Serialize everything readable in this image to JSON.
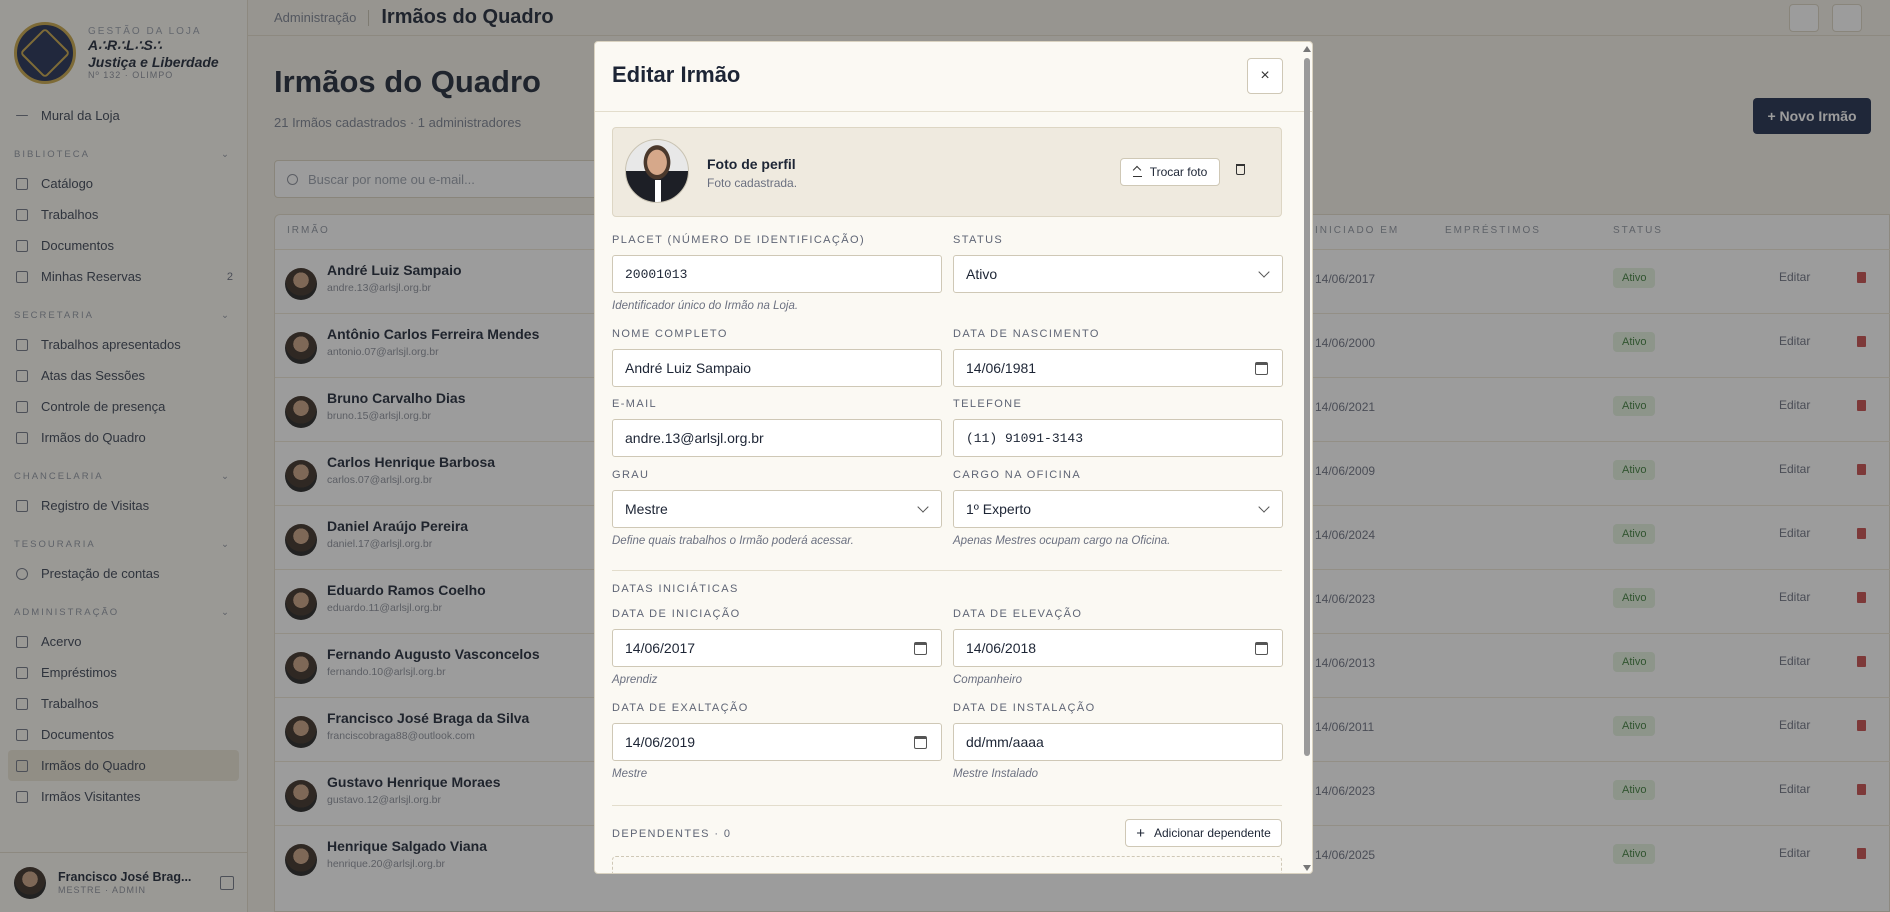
{
  "sidebar": {
    "eyebrow": "GESTÃO DA LOJA",
    "brand_name": "A∴R∴L∴S∴",
    "brand_name2": "Justiça e Liberdade",
    "brand_sub": "Nº 132 · OLIMPO",
    "back_item": "Mural da Loja",
    "sections": [
      {
        "title": "BIBLIOTECA",
        "items": [
          "Catálogo",
          "Trabalhos",
          "Documentos",
          "Minhas Reservas"
        ],
        "badge": "2"
      },
      {
        "title": "SECRETARIA",
        "items": [
          "Trabalhos apresentados",
          "Atas das Sessões",
          "Controle de presença",
          "Irmãos do Quadro"
        ]
      },
      {
        "title": "CHANCELARIA",
        "items": [
          "Registro de Visitas"
        ]
      },
      {
        "title": "TESOURARIA",
        "items": [
          "Prestação de contas"
        ]
      },
      {
        "title": "ADMINISTRAÇÃO",
        "items": [
          "Acervo",
          "Empréstimos",
          "Trabalhos",
          "Documentos",
          "Irmãos do Quadro",
          "Irmãos Visitantes"
        ]
      }
    ],
    "user_name": "Francisco José Brag...",
    "user_role": "MESTRE · ADMIN"
  },
  "topbar": {
    "crumb": "Administração",
    "current": "Irmãos do Quadro"
  },
  "page": {
    "title": "Irmãos do Quadro",
    "subtitle": "21 Irmãos cadastrados · 1 administradores",
    "new_button": "+ Novo Irmão",
    "search_placeholder": "Buscar por nome ou e-mail..."
  },
  "table": {
    "headers": [
      "IRMÃO",
      "INICIADO EM",
      "EMPRÉSTIMOS",
      "STATUS"
    ],
    "rows": [
      {
        "name": "André Luiz Sampaio",
        "email": "andre.13@arlsjl.org.br",
        "date": "14/06/2017",
        "status": "Ativo"
      },
      {
        "name": "Antônio Carlos Ferreira Mendes",
        "email": "antonio.07@arlsjl.org.br",
        "date": "14/06/2000",
        "status": "Ativo"
      },
      {
        "name": "Bruno Carvalho Dias",
        "email": "bruno.15@arlsjl.org.br",
        "date": "14/06/2021",
        "status": "Ativo"
      },
      {
        "name": "Carlos Henrique Barbosa",
        "email": "carlos.07@arlsjl.org.br",
        "date": "14/06/2009",
        "status": "Ativo"
      },
      {
        "name": "Daniel Araújo Pereira",
        "email": "daniel.17@arlsjl.org.br",
        "date": "14/06/2024",
        "status": "Ativo"
      },
      {
        "name": "Eduardo Ramos Coelho",
        "email": "eduardo.11@arlsjl.org.br",
        "date": "14/06/2023",
        "status": "Ativo"
      },
      {
        "name": "Fernando Augusto Vasconcelos",
        "email": "fernando.10@arlsjl.org.br",
        "date": "14/06/2013",
        "status": "Ativo"
      },
      {
        "name": "Francisco José Braga da Silva",
        "email": "franciscobraga88@outlook.com",
        "date": "14/06/2011",
        "status": "Ativo"
      },
      {
        "name": "Gustavo Henrique Moraes",
        "email": "gustavo.12@arlsjl.org.br",
        "date": "14/06/2023",
        "status": "Ativo"
      },
      {
        "name": "Henrique Salgado Viana",
        "email": "henrique.20@arlsjl.org.br",
        "date": "14/06/2025",
        "status": "Ativo"
      }
    ],
    "edit_label": "Editar"
  },
  "modal": {
    "title": "Editar Irmão",
    "close": "×",
    "photo_title": "Foto de perfil",
    "photo_sub": "Foto cadastrada.",
    "swap_photo": "Trocar foto",
    "placet_label": "PLACET (NÚMERO DE IDENTIFICAÇÃO)",
    "placet_value": "20001013",
    "placet_hint": "Identificador único do Irmão na Loja.",
    "status_label": "STATUS",
    "status_value": "Ativo",
    "name_label": "NOME COMPLETO",
    "name_value": "André Luiz Sampaio",
    "birth_label": "DATA DE NASCIMENTO",
    "birth_value": "14/06/1981",
    "email_label": "E-MAIL",
    "email_value": "andre.13@arlsjl.org.br",
    "phone_label": "TELEFONE",
    "phone_value": "(11) 91091-3143",
    "degree_label": "GRAU",
    "degree_value": "Mestre",
    "degree_hint": "Define quais trabalhos o Irmão poderá acessar.",
    "office_label": "CARGO NA OFICINA",
    "office_value": "1º Experto",
    "office_hint": "Apenas Mestres ocupam cargo na Oficina.",
    "dates_section": "DATAS INICIÁTICAS",
    "init_label": "DATA DE INICIAÇÃO",
    "init_value": "14/06/2017",
    "init_hint": "Aprendiz",
    "elev_label": "DATA DE ELEVAÇÃO",
    "elev_value": "14/06/2018",
    "elev_hint": "Companheiro",
    "exalt_label": "DATA DE EXALTAÇÃO",
    "exalt_value": "14/06/2019",
    "exalt_hint": "Mestre",
    "install_label": "DATA DE INSTALAÇÃO",
    "install_value": "dd/mm/aaaa",
    "install_hint": "Mestre Instalado",
    "dependents_label": "DEPENDENTES · 0",
    "add_dependent": "Adicionar dependente"
  }
}
